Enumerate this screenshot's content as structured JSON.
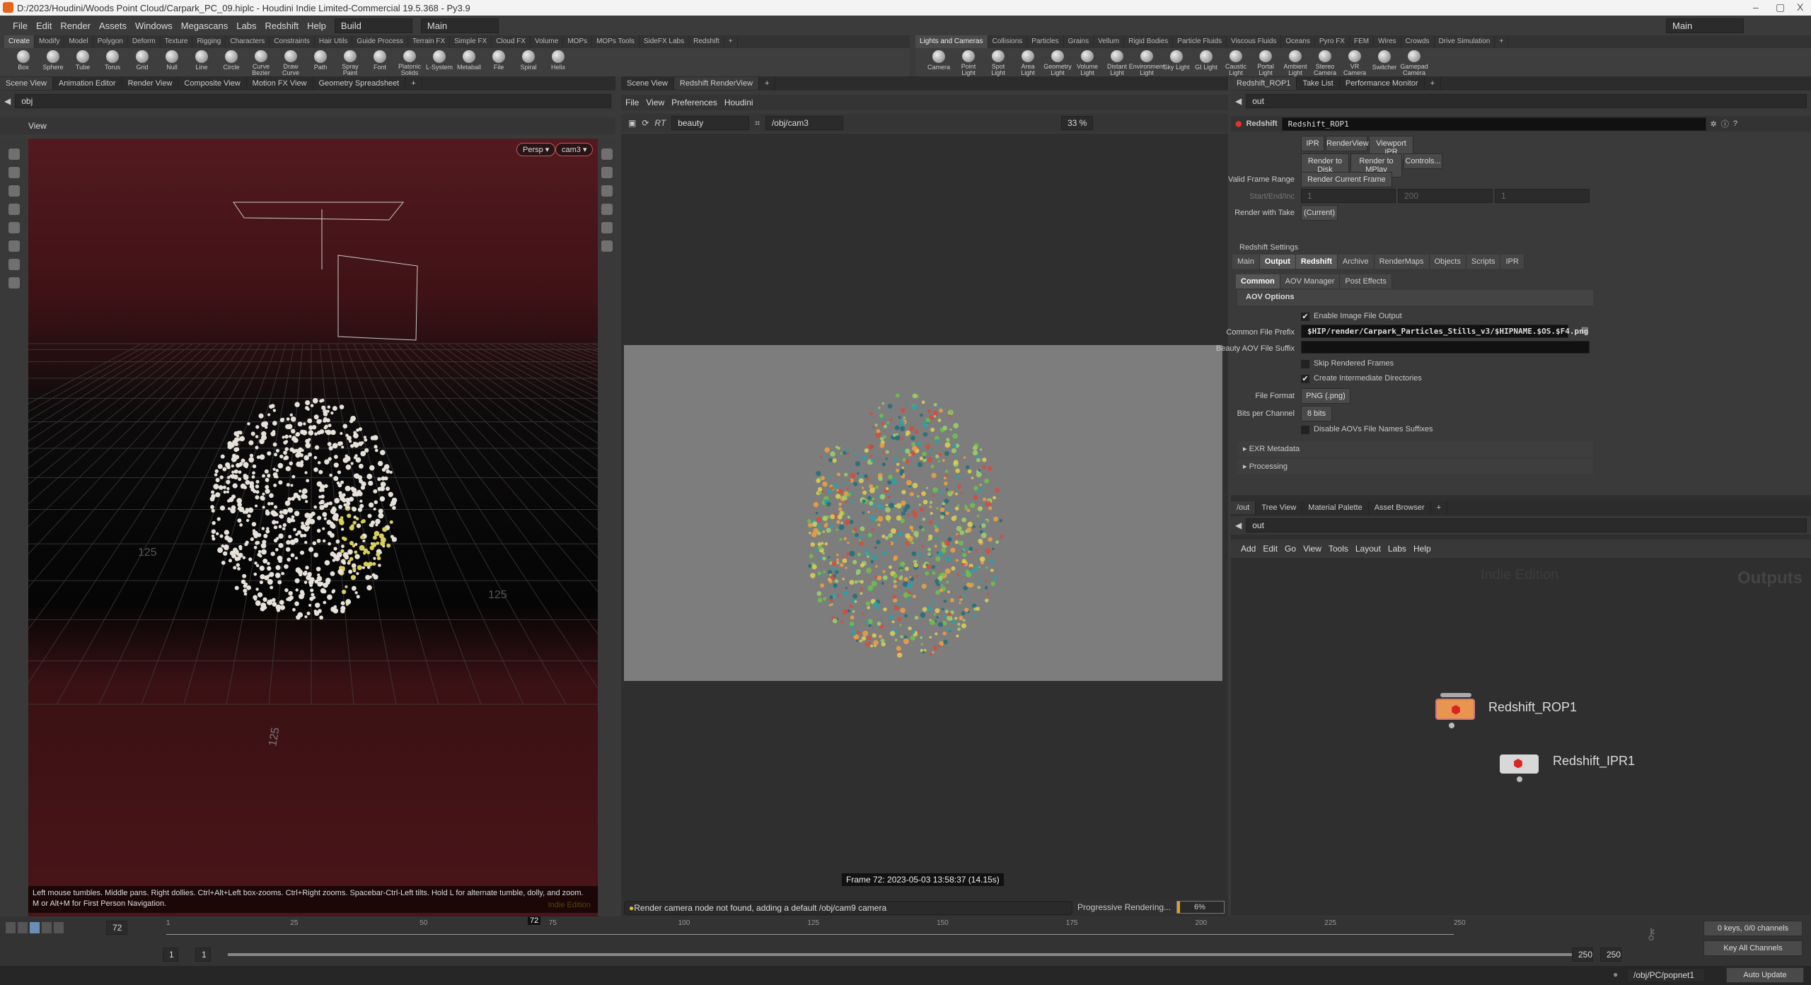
{
  "window": {
    "title": "D:/2023/Houdini/Woods Point Cloud/Carpark_PC_09.hiplc - Houdini Indie Limited-Commercial 19.5.368 - Py3.9",
    "min": "–",
    "max": "▢",
    "close": "X"
  },
  "menu": {
    "items": [
      "File",
      "Edit",
      "Render",
      "Assets",
      "Windows",
      "Megascans",
      "Labs",
      "Redshift",
      "Help"
    ],
    "desktop": "Build",
    "context": "Main",
    "right_desktop": "Main"
  },
  "shelf_left": {
    "tabs": [
      "Create",
      "Modify",
      "Model",
      "Polygon",
      "Deform",
      "Texture",
      "Rigging",
      "Characters",
      "Constraints",
      "Hair Utils",
      "Guide Process",
      "Terrain FX",
      "Simple FX",
      "Cloud FX",
      "Volume",
      "MOPs",
      "MOPs Tools",
      "SideFX Labs",
      "Redshift"
    ],
    "tools": [
      "Box",
      "Sphere",
      "Tube",
      "Torus",
      "Grid",
      "Null",
      "Line",
      "Circle",
      "Curve Bezier",
      "Draw Curve",
      "Path",
      "Spray Paint",
      "Font",
      "Platonic Solids",
      "L-System",
      "Metaball",
      "File",
      "Spiral",
      "Helix"
    ]
  },
  "shelf_right": {
    "tabs": [
      "Lights and Cameras",
      "Collisions",
      "Particles",
      "Grains",
      "Vellum",
      "Rigid Bodies",
      "Particle Fluids",
      "Viscous Fluids",
      "Oceans",
      "Pyro FX",
      "FEM",
      "Wires",
      "Crowds",
      "Drive Simulation"
    ],
    "tools": [
      "Camera",
      "Point Light",
      "Spot Light",
      "Area Light",
      "Geometry Light",
      "Volume Light",
      "Distant Light",
      "Environment Light",
      "Sky Light",
      "GI Light",
      "Caustic Light",
      "Portal Light",
      "Ambient Light",
      "Stereo Camera",
      "VR Camera",
      "Switcher",
      "Gamepad Camera"
    ]
  },
  "left_pane": {
    "tabs": [
      "Scene View",
      "Animation Editor",
      "Render View",
      "Composite View",
      "Motion FX View",
      "Geometry Spreadsheet"
    ],
    "path": "obj",
    "view_label": "View",
    "persp": "Persp ▾",
    "camera": "cam3 ▾",
    "hint": "Left mouse tumbles. Middle pans. Right dollies. Ctrl+Alt+Left box-zooms. Ctrl+Right zooms. Spacebar-Ctrl-Left tilts. Hold L for alternate tumble, dolly, and zoom.",
    "hint2": "M or Alt+M for First Person Navigation.",
    "watermark": "Indie Edition",
    "grid_labels": [
      "125",
      "125",
      "125"
    ]
  },
  "center_pane": {
    "tabs": [
      "Scene View",
      "Redshift RenderView"
    ],
    "menu": [
      "File",
      "View",
      "Preferences",
      "Houdini"
    ],
    "rt": "RT",
    "aov": "beauty",
    "camera_path": "/obj/cam3",
    "zoom": "33 %",
    "frame_info": "Frame 72: 2023-05-03 13:58:37 (14.15s)",
    "status": "Render camera node not found, adding a default /obj/cam9 camera",
    "progress_label": "Progressive Rendering...",
    "progress_text": "6%",
    "progress": 0.06
  },
  "param_pane": {
    "tabs": [
      "Redshift_ROP1",
      "Take List",
      "Performance Monitor"
    ],
    "path": "out",
    "node_type": "Redshift",
    "node_name": "Redshift_ROP1",
    "buttons_row1": [
      "IPR",
      "RenderView",
      "Viewport IPR"
    ],
    "buttons_row2": [
      "Render to Disk",
      "Render to MPlay",
      "Controls..."
    ],
    "valid_frame_range_label": "Valid Frame Range",
    "valid_frame_range": "Render Current Frame",
    "start_end_label": "Start/End/Inc",
    "start": "1",
    "end": "200",
    "inc": "1",
    "take_label": "Render with Take",
    "take": "(Current)",
    "settings_label": "Redshift Settings",
    "settings_tabs": [
      "Main",
      "Output",
      "Redshift",
      "Archive",
      "RenderMaps",
      "Objects",
      "Scripts",
      "IPR"
    ],
    "sub_tabs": [
      "Common",
      "AOV Manager",
      "Post Effects"
    ],
    "section": "AOV Options",
    "enable_output": "Enable Image File Output",
    "prefix_label": "Common File Prefix",
    "prefix": "$HIP/render/Carpark_Particles_Stills_v3/$HIPNAME.$OS.$F4.png",
    "suffix_label": "Beauty AOV File Suffix",
    "suffix": "",
    "skip": "Skip Rendered Frames",
    "create_dirs": "Create Intermediate Directories",
    "format_label": "File Format",
    "format": "PNG (.png)",
    "bits_label": "Bits per Channel",
    "bits": "8 bits",
    "disable_suffix": "Disable AOVs File Names Suffixes",
    "exr": "EXR Metadata",
    "processing": "Processing",
    "checks": {
      "enable_output": true,
      "skip": false,
      "create_dirs": true,
      "disable_suffix": false
    }
  },
  "network_pane": {
    "tabs": [
      "/out",
      "Tree View",
      "Material Palette",
      "Asset Browser"
    ],
    "path": "out",
    "menu": [
      "Add",
      "Edit",
      "Go",
      "View",
      "Tools",
      "Layout",
      "Labs",
      "Help"
    ],
    "watermark": "Indie Edition",
    "context_label": "Outputs",
    "nodes": [
      {
        "name": "Redshift_ROP1",
        "color": "#e8954f"
      },
      {
        "name": "Redshift_IPR1",
        "color": "#d8d8d8"
      }
    ]
  },
  "timeline": {
    "frame": "72",
    "ticks": [
      "1",
      "25",
      "50",
      "75",
      "100",
      "125",
      "150",
      "175",
      "200",
      "225",
      "250"
    ],
    "start": "1",
    "start2": "1",
    "end": "250",
    "end2": "250",
    "keys": "0 keys, 0/0 channels",
    "key_all": "Key All Channels",
    "cursor": "72"
  },
  "bottom": {
    "node_path": "/obj/PC/popnet1",
    "update": "Auto Update"
  }
}
